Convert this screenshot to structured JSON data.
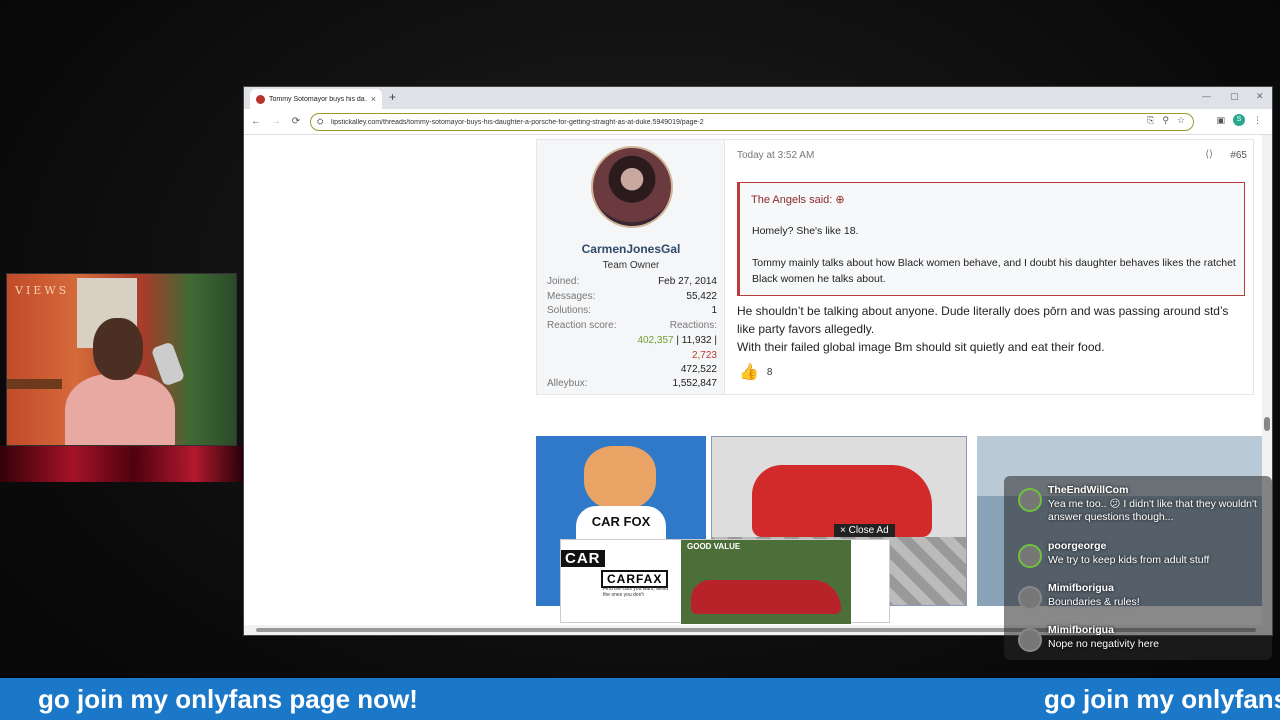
{
  "browser": {
    "tab_title": "Tommy Sotomayor buys his da…",
    "tab_close": "×",
    "new_tab": "+",
    "win_min": "—",
    "win_max": "▢",
    "win_close": "✕",
    "url": "lipstickalley.com/threads/tommy-sotomayor-buys-his-daughter-a-porsche-for-getting-straight-as-at-duke.5949019/page-2",
    "profile_initial": "S"
  },
  "post": {
    "username": "CarmenJonesGal",
    "user_title": "Team Owner",
    "stats": {
      "joined_label": "Joined:",
      "joined": "Feb 27, 2014",
      "messages_label": "Messages:",
      "messages": "55,422",
      "solutions_label": "Solutions:",
      "solutions": "1",
      "reaction_label": "Reaction score:",
      "reactions_label": "Reactions:",
      "reactions_green": "402,357",
      "reactions_sep": " | 11,932 |",
      "reactions_red": "2,723",
      "reactions_total": "472,522",
      "alleybux_label": "Alleybux:",
      "alleybux": "1,552,847"
    },
    "date": "Today at 3:52 AM",
    "number": "#65",
    "quote": {
      "author": "The Angels said:",
      "line1": "Homely? She's like 18.",
      "line2": "Tommy mainly talks about how Black women behave, and I doubt his daughter behaves likes the ratchet Black women he talks about."
    },
    "body": {
      "line1": "He shouldn’t be talking about anyone. Dude literally does pōrn and was passing around std’s like party favors allegedly.",
      "line2": "With their failed global image Bm should sit quietly and eat their food."
    },
    "likes": "8"
  },
  "ads": {
    "fox_shirt": "CAR FOX",
    "close_ad": "× Close Ad",
    "car_badge": "CAR",
    "carfax_logo": "CARFAX",
    "carfax_tag": "Find the cars you want, avoid the ones you don't",
    "good_value": "GOOD VALUE"
  },
  "webcam": {
    "sign": "VIEWS"
  },
  "chat": [
    {
      "name": "TheEndWillCom",
      "text": "Yea me too.. 😕 I didn't like that they wouldn't answer questions though..."
    },
    {
      "name": "poorgeorge",
      "text": "We try to keep kids from adult stuff"
    },
    {
      "name": "Mimifborigua",
      "text": "Boundaries & rules!"
    },
    {
      "name": "Mimifborigua",
      "text": "Nope no negativity here"
    }
  ],
  "ticker": {
    "text": "go join my onlyfans page now!",
    "text_repeat": "go join my onlyfans"
  }
}
